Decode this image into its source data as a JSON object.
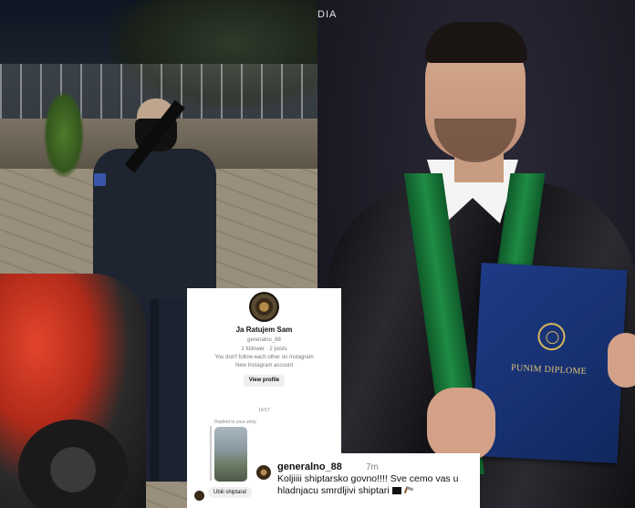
{
  "photo_right": {
    "media_label": "DIA"
  },
  "diploma": {
    "text": "PUNIM DIPLOME"
  },
  "instagram": {
    "profile_name": "Ja Ratujem Sam",
    "handle": "generalno_88",
    "stats": "1 follower · 2 posts",
    "follow_note": "You don't follow each other on Instagram",
    "new_account_note": "New Instagram account",
    "view_profile_label": "View profile",
    "timestamp": "16:57",
    "replied_label": "Replied to your story",
    "message": "Ubiii shiptara!"
  },
  "comment": {
    "username": "generalno_88",
    "time_ago": "7m",
    "text": "Koljiiii shiptarsko govno!!!! Sve cemo vas u hladnjacu smrdljivi shiptari"
  }
}
